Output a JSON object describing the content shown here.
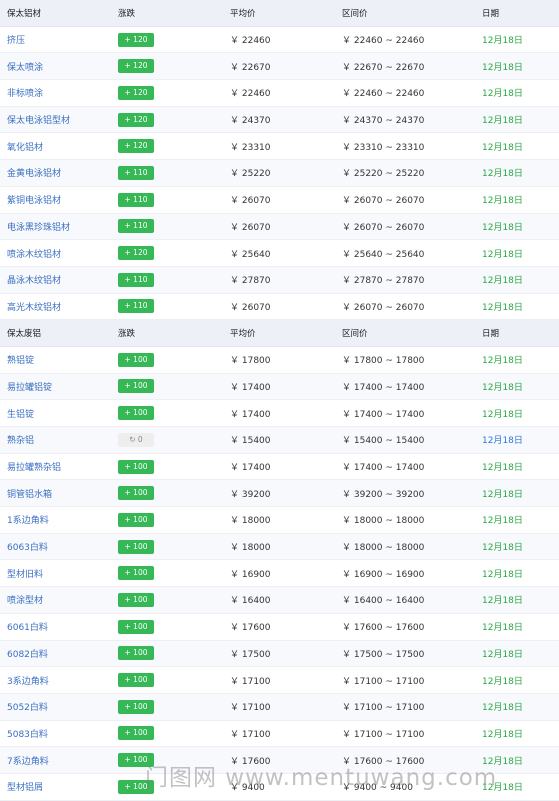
{
  "colors": {
    "up": "#36b857",
    "flat": "#eeeeee",
    "date_green": "#2aa744",
    "date_blue": "#2d78d6",
    "link": "#3a6fc2"
  },
  "sections": [
    {
      "header": {
        "name": "保太铝材",
        "change": "涨跌",
        "avg": "平均价",
        "range": "区间价",
        "date": "日期"
      },
      "rows": [
        {
          "name": "挤压",
          "change": "+ 120",
          "avg": "￥ 22460",
          "range": "￥ 22460 ~ 22460",
          "date": "12月18日"
        },
        {
          "name": "保太喷涂",
          "change": "+ 120",
          "avg": "￥ 22670",
          "range": "￥ 22670 ~ 22670",
          "date": "12月18日"
        },
        {
          "name": "非标喷涂",
          "change": "+ 120",
          "avg": "￥ 22460",
          "range": "￥ 22460 ~ 22460",
          "date": "12月18日"
        },
        {
          "name": "保太电泳铝型材",
          "change": "+ 120",
          "avg": "￥ 24370",
          "range": "￥ 24370 ~ 24370",
          "date": "12月18日"
        },
        {
          "name": "氧化铝材",
          "change": "+ 120",
          "avg": "￥ 23310",
          "range": "￥ 23310 ~ 23310",
          "date": "12月18日"
        },
        {
          "name": "金黄电泳铝材",
          "change": "+ 110",
          "avg": "￥ 25220",
          "range": "￥ 25220 ~ 25220",
          "date": "12月18日"
        },
        {
          "name": "紫铜电泳铝材",
          "change": "+ 110",
          "avg": "￥ 26070",
          "range": "￥ 26070 ~ 26070",
          "date": "12月18日"
        },
        {
          "name": "电泳黑珍珠铝材",
          "change": "+ 110",
          "avg": "￥ 26070",
          "range": "￥ 26070 ~ 26070",
          "date": "12月18日"
        },
        {
          "name": "喷涂木纹铝材",
          "change": "+ 120",
          "avg": "￥ 25640",
          "range": "￥ 25640 ~ 25640",
          "date": "12月18日"
        },
        {
          "name": "晶泳木纹铝材",
          "change": "+ 110",
          "avg": "￥ 27870",
          "range": "￥ 27870 ~ 27870",
          "date": "12月18日"
        },
        {
          "name": "高光木纹铝材",
          "change": "+ 110",
          "avg": "￥ 26070",
          "range": "￥ 26070 ~ 26070",
          "date": "12月18日"
        }
      ]
    },
    {
      "header": {
        "name": "保太废铝",
        "change": "涨跌",
        "avg": "平均价",
        "range": "区间价",
        "date": "日期"
      },
      "rows": [
        {
          "name": "熟铝锭",
          "change": "+ 100",
          "avg": "￥ 17800",
          "range": "￥ 17800 ~ 17800",
          "date": "12月18日"
        },
        {
          "name": "易拉罐铝锭",
          "change": "+ 100",
          "avg": "￥ 17400",
          "range": "￥ 17400 ~ 17400",
          "date": "12月18日"
        },
        {
          "name": "生铝锭",
          "change": "+ 100",
          "avg": "￥ 17400",
          "range": "￥ 17400 ~ 17400",
          "date": "12月18日"
        },
        {
          "name": "熟杂铝",
          "change": "↻ 0",
          "avg": "￥ 15400",
          "range": "￥ 15400 ~ 15400",
          "date": "12月18日",
          "flat": true
        },
        {
          "name": "易拉罐熟杂铝",
          "change": "+ 100",
          "avg": "￥ 17400",
          "range": "￥ 17400 ~ 17400",
          "date": "12月18日"
        },
        {
          "name": "铜管铝水箱",
          "change": "+ 100",
          "avg": "￥ 39200",
          "range": "￥ 39200 ~ 39200",
          "date": "12月18日"
        },
        {
          "name": "1系边角料",
          "change": "+ 100",
          "avg": "￥ 18000",
          "range": "￥ 18000 ~ 18000",
          "date": "12月18日"
        },
        {
          "name": "6063白料",
          "change": "+ 100",
          "avg": "￥ 18000",
          "range": "￥ 18000 ~ 18000",
          "date": "12月18日"
        },
        {
          "name": "型材旧料",
          "change": "+ 100",
          "avg": "￥ 16900",
          "range": "￥ 16900 ~ 16900",
          "date": "12月18日"
        },
        {
          "name": "喷涂型材",
          "change": "+ 100",
          "avg": "￥ 16400",
          "range": "￥ 16400 ~ 16400",
          "date": "12月18日"
        },
        {
          "name": "6061白料",
          "change": "+ 100",
          "avg": "￥ 17600",
          "range": "￥ 17600 ~ 17600",
          "date": "12月18日"
        },
        {
          "name": "6082白料",
          "change": "+ 100",
          "avg": "￥ 17500",
          "range": "￥ 17500 ~ 17500",
          "date": "12月18日"
        },
        {
          "name": "3系边角料",
          "change": "+ 100",
          "avg": "￥ 17100",
          "range": "￥ 17100 ~ 17100",
          "date": "12月18日"
        },
        {
          "name": "5052白料",
          "change": "+ 100",
          "avg": "￥ 17100",
          "range": "￥ 17100 ~ 17100",
          "date": "12月18日"
        },
        {
          "name": "5083白料",
          "change": "+ 100",
          "avg": "￥ 17100",
          "range": "￥ 17100 ~ 17100",
          "date": "12月18日"
        },
        {
          "name": "7系边角料",
          "change": "+ 100",
          "avg": "￥ 17600",
          "range": "￥ 17600 ~ 17600",
          "date": "12月18日"
        },
        {
          "name": "型材铝屑",
          "change": "+ 100",
          "avg": "￥ 9400",
          "range": "￥ 9400 ~ 9400",
          "date": "12月18日"
        }
      ]
    }
  ],
  "watermark": "门图网 www.mentuwang.com"
}
